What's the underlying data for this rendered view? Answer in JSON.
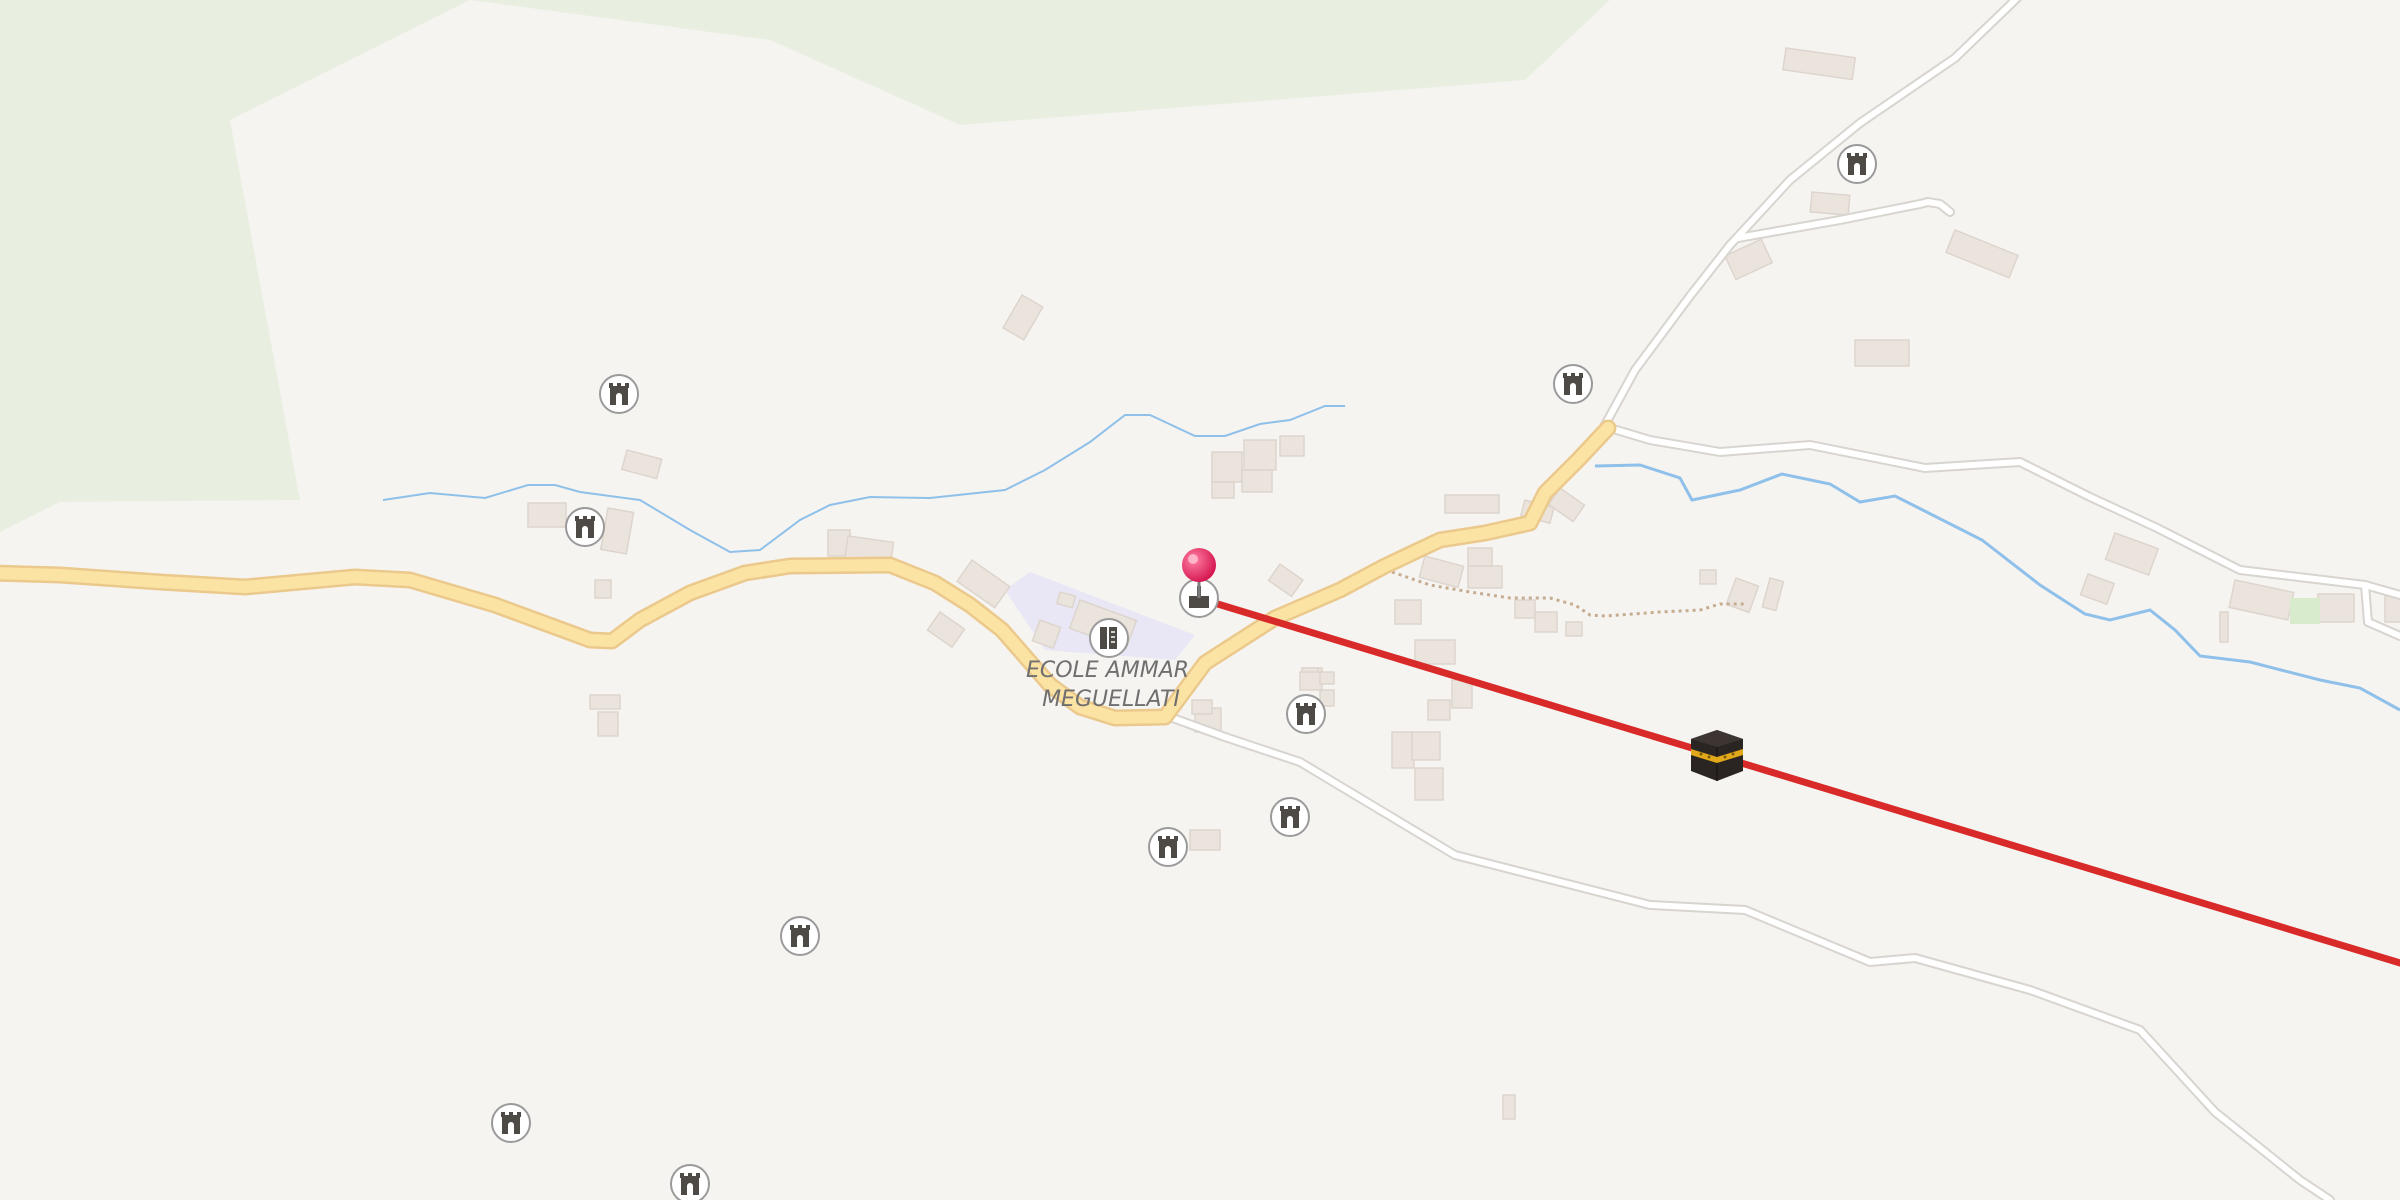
{
  "map": {
    "labels": {
      "school_line1": "ECOLE AMMAR",
      "school_line2": "MEGUELLATI"
    },
    "icons": {
      "castle": "castle-icon",
      "school": "school-icon",
      "pin": "location-pin-icon",
      "kaaba": "kaaba-icon"
    },
    "colors": {
      "background": "#f6f4f1",
      "green_area": "#e8efe1",
      "main_road": "#fbe3a4",
      "main_road_casing": "#ebc98c",
      "minor_road": "#ffffff",
      "minor_road_casing": "#d8d4cf",
      "stream": "#8fc0ea",
      "building": "#ebe4dd",
      "qibla_line": "#d92a2a",
      "pin": "#e8366a",
      "school_area": "#e9e6f5"
    }
  }
}
